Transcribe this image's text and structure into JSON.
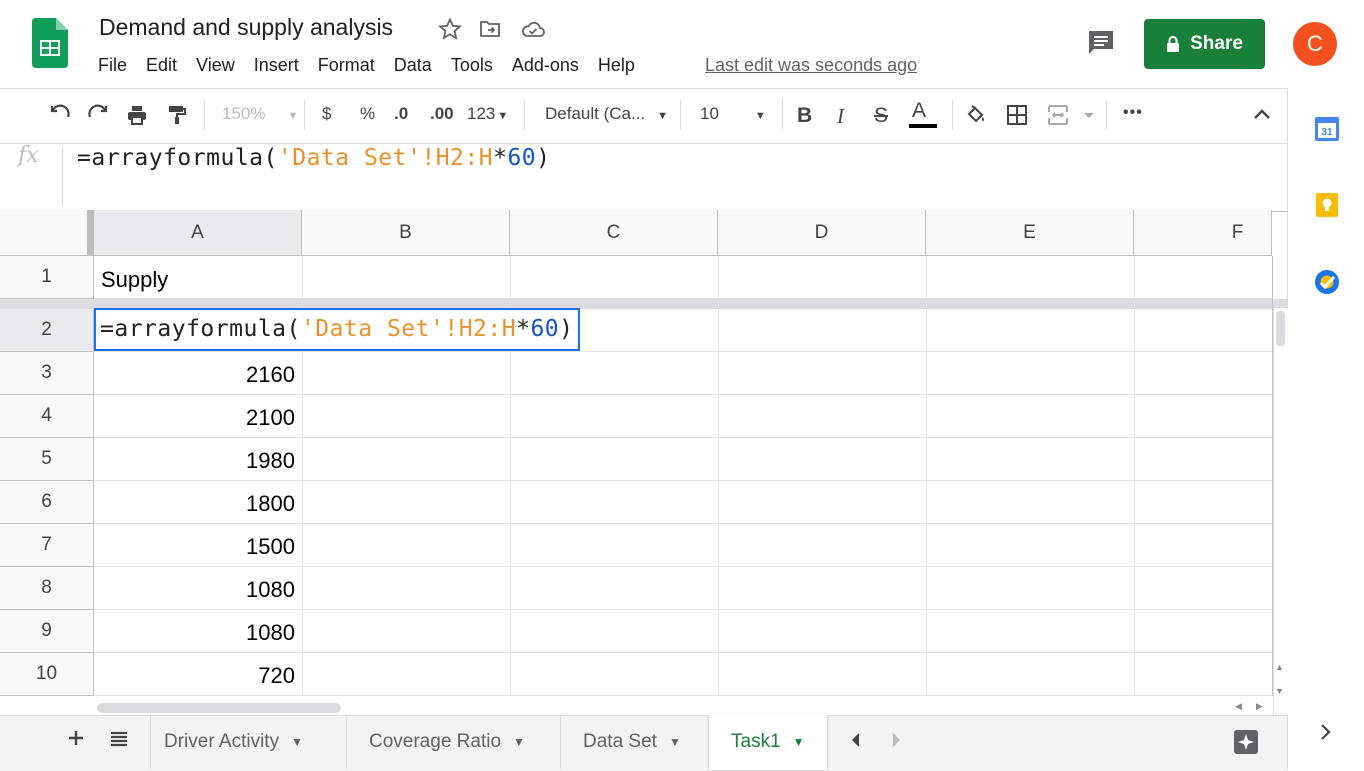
{
  "app": {
    "title": "Demand and supply analysis",
    "last_edit": "Last edit was seconds ago",
    "share_label": "Share",
    "avatar_initial": "C"
  },
  "menu": [
    "File",
    "Edit",
    "View",
    "Insert",
    "Format",
    "Data",
    "Tools",
    "Add-ons",
    "Help"
  ],
  "toolbar": {
    "zoom": "150%",
    "currency": "$",
    "percent": "%",
    "decrease_decimal": ".0",
    "increase_decimal": ".00",
    "more_formats": "123",
    "font": "Default (Ca...",
    "font_size": "10",
    "bold": "B",
    "italic": "I",
    "strike": "S",
    "text_color": "A",
    "more": "•••"
  },
  "formula_bar": {
    "fx": "fx",
    "prefix": "=arrayformula(",
    "string_part": "'Data Set'!H2:H",
    "operator": "*",
    "number_part": "60",
    "suffix": ")"
  },
  "grid": {
    "columns": [
      "A",
      "B",
      "C",
      "D",
      "E",
      "F"
    ],
    "rows": [
      "1",
      "2",
      "3",
      "4",
      "5",
      "6",
      "7",
      "8",
      "9",
      "10"
    ],
    "a1": "Supply",
    "values": [
      "2160",
      "2100",
      "1980",
      "1800",
      "1500",
      "1080",
      "1080",
      "720"
    ]
  },
  "tabs": {
    "sheets": [
      "Driver Activity",
      "Coverage Ratio",
      "Data Set",
      "Task1"
    ],
    "active": "Task1"
  },
  "colors": {
    "share_green": "#188038",
    "active_tab": "#188038",
    "selection": "#1a73e8",
    "formula_string": "#e8912d",
    "formula_number": "#1155cc",
    "avatar": "#f4511e"
  }
}
